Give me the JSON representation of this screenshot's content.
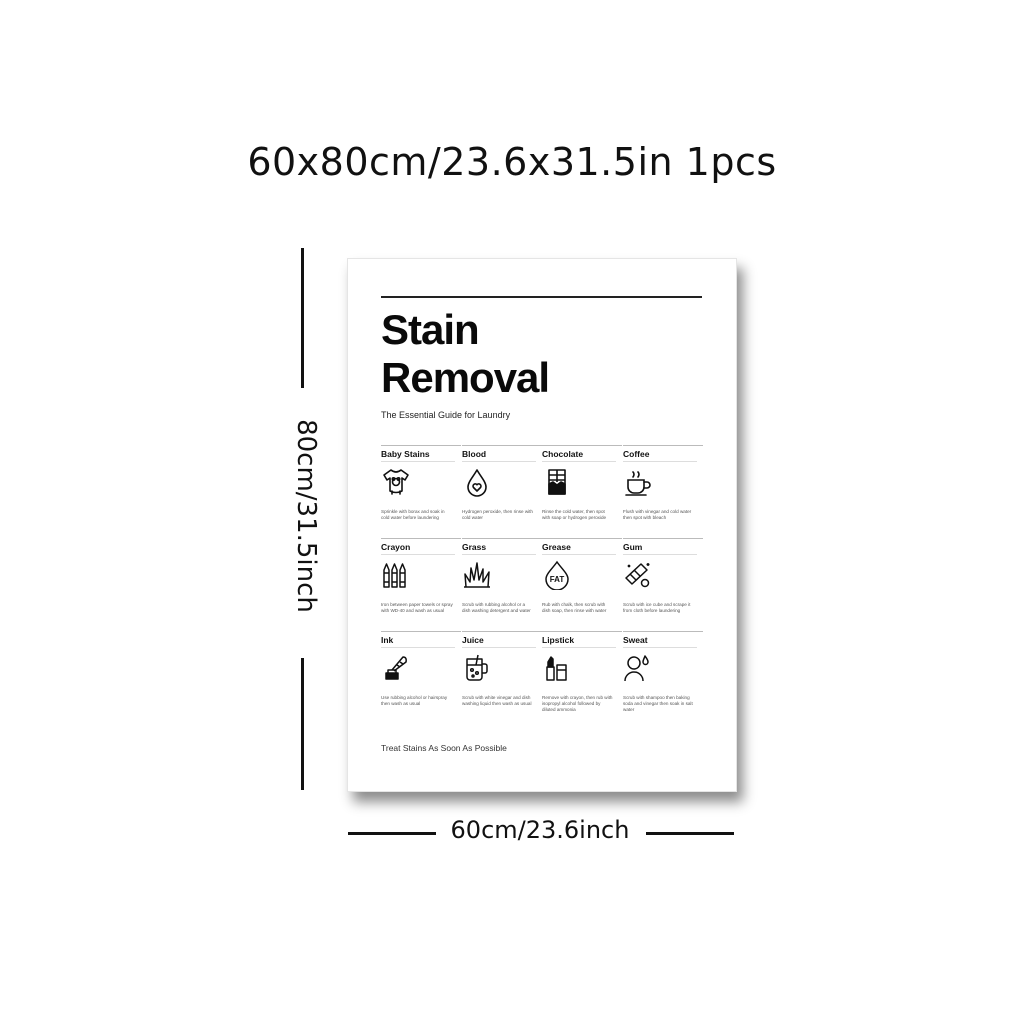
{
  "headline": "60x80cm/23.6x31.5in 1pcs",
  "height_label": "80cm/31.5inch",
  "width_label": "60cm/23.6inch",
  "poster": {
    "title_line1": "Stain",
    "title_line2": "Removal",
    "subtitle": "The Essential Guide for Laundry",
    "footer": "Treat Stains As Soon As Possible",
    "rows": [
      [
        {
          "title": "Baby Stains",
          "icon": "onesie-icon",
          "desc": "Sprinkle with borax and soak in cold water before laundering"
        },
        {
          "title": "Blood",
          "icon": "blood-drop-icon",
          "desc": "Hydrogen peroxide, then rinse with cold water"
        },
        {
          "title": "Chocolate",
          "icon": "chocolate-bar-icon",
          "desc": "Rinse the cold water, then spot with soap or hydrogen peroxide"
        },
        {
          "title": "Coffee",
          "icon": "coffee-cup-icon",
          "desc": "Flush with vinegar and cold water then spot with bleach"
        }
      ],
      [
        {
          "title": "Crayon",
          "icon": "crayons-icon",
          "desc": "Iron between paper towels or spray with WD-40 and wash as usual"
        },
        {
          "title": "Grass",
          "icon": "grass-icon",
          "desc": "Scrub with rubbing alcohol or a dish washing detergent and water"
        },
        {
          "title": "Grease",
          "icon": "fat-drop-icon",
          "desc": "Rub with chalk, then scrub with dish soap, then rinse with water"
        },
        {
          "title": "Gum",
          "icon": "chewing-gum-icon",
          "desc": "Scrub with ice cube and scrape it from cloth before laundering"
        }
      ],
      [
        {
          "title": "Ink",
          "icon": "inkwell-quill-icon",
          "desc": "Use rubbing alcohol or hairspray then wash as usual"
        },
        {
          "title": "Juice",
          "icon": "juice-jar-icon",
          "desc": "Scrub with white vinegar and dish washing liquid then wash as usual"
        },
        {
          "title": "Lipstick",
          "icon": "lipstick-icon",
          "desc": "Remove with crayon, then rub with isopropyl alcohol followed by diluted ammonia"
        },
        {
          "title": "Sweat",
          "icon": "sweating-person-icon",
          "desc": "Scrub with shampoo then baking soda and vinegar then soak in salt water"
        }
      ]
    ]
  }
}
